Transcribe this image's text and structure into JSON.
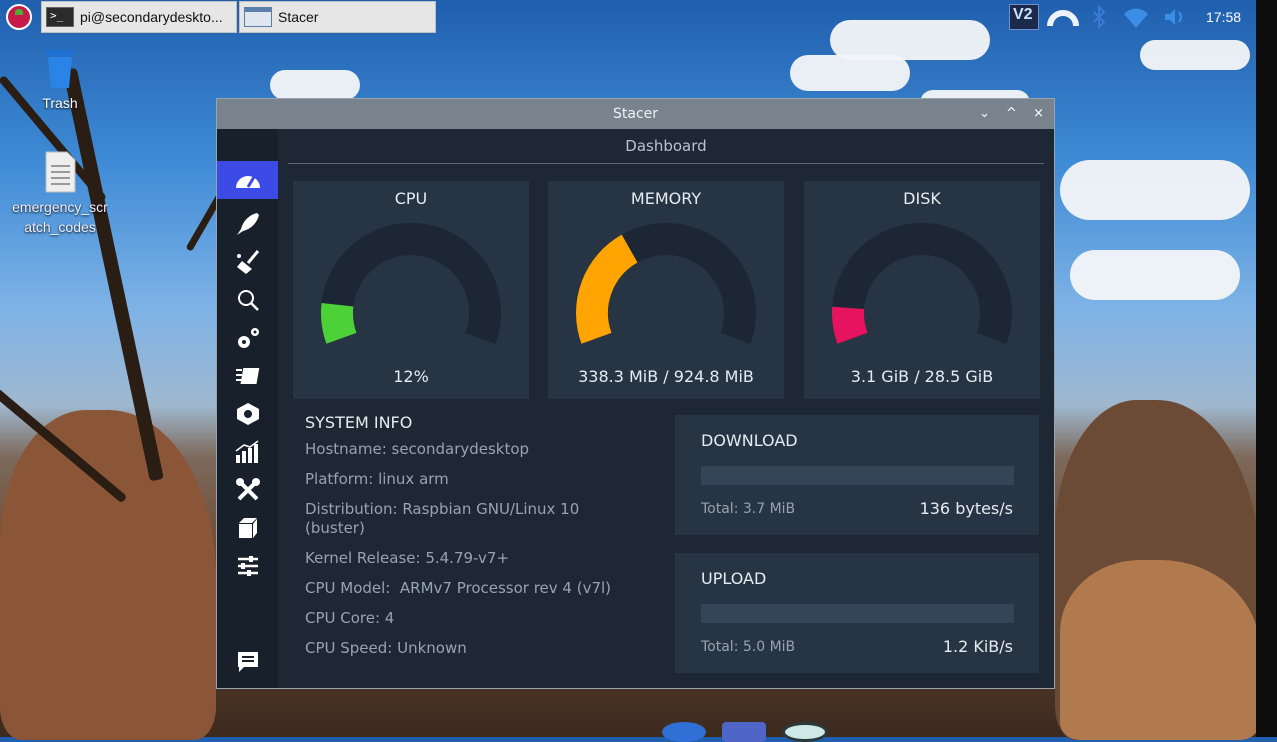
{
  "taskbar": {
    "tasks": [
      {
        "label": "pi@secondarydeskto..."
      },
      {
        "label": "Stacer"
      }
    ],
    "clock": "17:58"
  },
  "desktop": {
    "icons": [
      {
        "label": "Trash"
      },
      {
        "label": "emergency_scr\natch_codes"
      }
    ]
  },
  "window": {
    "title": "Stacer",
    "controls": [
      "⌄",
      "^",
      "×"
    ]
  },
  "sidebar": {
    "items": [
      {
        "icon": "dashboard-icon",
        "active": true
      },
      {
        "icon": "startup-apps-icon"
      },
      {
        "icon": "system-cleaner-icon"
      },
      {
        "icon": "search-icon"
      },
      {
        "icon": "services-icon"
      },
      {
        "icon": "processes-icon"
      },
      {
        "icon": "uninstaller-icon"
      },
      {
        "icon": "resources-icon"
      },
      {
        "icon": "helpers-icon"
      },
      {
        "icon": "apt-repository-icon"
      },
      {
        "icon": "settings-icon"
      },
      {
        "icon": "feedback-icon"
      }
    ]
  },
  "dashboard": {
    "title": "Dashboard",
    "gauges": [
      {
        "title": "CPU",
        "value": "12%",
        "fraction": 0.12,
        "color": "#4cd137"
      },
      {
        "title": "MEMORY",
        "value": "338.3 MiB / 924.8 MiB",
        "fraction": 0.366,
        "color": "#ffa400"
      },
      {
        "title": "DISK",
        "value": "3.1 GiB / 28.5 GiB",
        "fraction": 0.109,
        "color": "#e6145e"
      }
    ],
    "system_info": {
      "title": "SYSTEM INFO",
      "lines": [
        "Hostname: secondarydesktop",
        "Platform: linux arm",
        "Distribution: Raspbian GNU/Linux 10 (buster)",
        "Kernel Release: 5.4.79-v7+",
        "CPU Model:  ARMv7 Processor rev 4 (v7l)",
        "CPU Core: 4",
        "CPU Speed: Unknown"
      ]
    },
    "network": {
      "download": {
        "label": "DOWNLOAD",
        "total": "Total: 3.7 MiB",
        "speed": "136 bytes/s",
        "fraction": 0.0
      },
      "upload": {
        "label": "UPLOAD",
        "total": "Total: 5.0 MiB",
        "speed": "1.2 KiB/s",
        "fraction": 0.0
      }
    }
  },
  "colors": {
    "accent": "#3c4ae6",
    "window_bg": "#1e2835",
    "card_bg": "#273444",
    "gauge_track": "#1c2634"
  }
}
